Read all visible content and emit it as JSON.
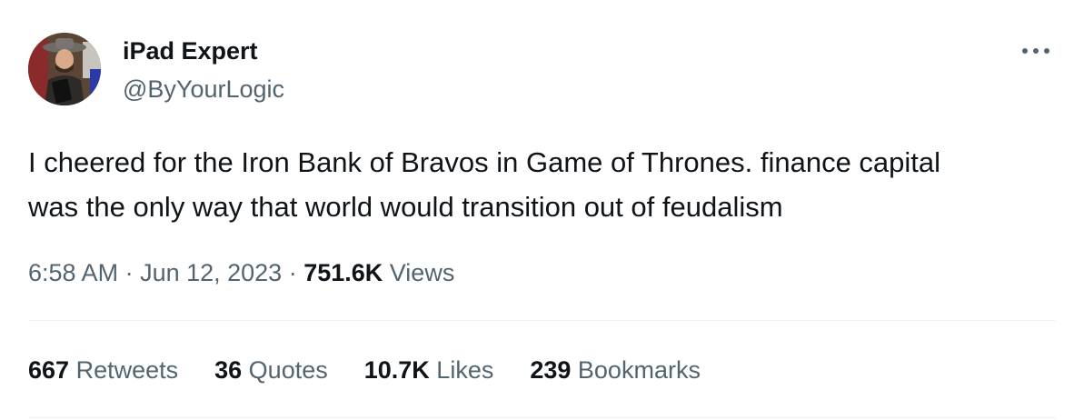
{
  "author": {
    "display_name": "iPad Expert",
    "handle": "@ByYourLogic",
    "avatar_icon": "user-avatar"
  },
  "more_icon": "more-horizontal-icon",
  "tweet": {
    "text_line1": "I cheered for the Iron Bank of Bravos in Game of Thrones. finance capital",
    "text_line2": "was the only way that world would transition out of feudalism"
  },
  "meta": {
    "time": "6:58 AM",
    "separator1": " · ",
    "date": "Jun 12, 2023",
    "separator2": " · ",
    "views_count": "751.6K",
    "views_label": " Views"
  },
  "stats": {
    "retweets": {
      "count": "667",
      "label": " Retweets"
    },
    "quotes": {
      "count": "36",
      "label": " Quotes"
    },
    "likes": {
      "count": "10.7K",
      "label": " Likes"
    },
    "bookmarks": {
      "count": "239",
      "label": " Bookmarks"
    }
  },
  "colors": {
    "primary_text": "#0f1419",
    "secondary_text": "#536471",
    "divider": "#eff3f4"
  }
}
